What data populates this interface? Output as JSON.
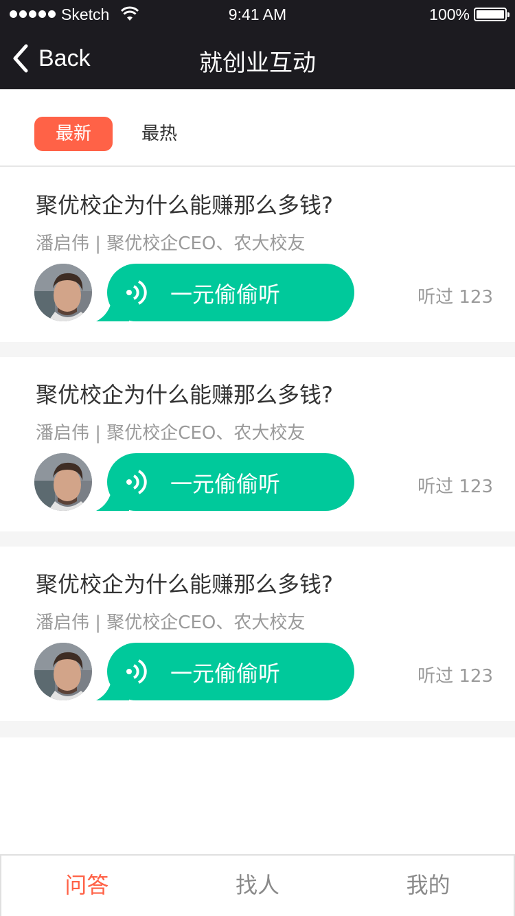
{
  "status": {
    "carrier": "Sketch",
    "time": "9:41 AM",
    "battery": "100%"
  },
  "nav": {
    "back_label": "Back",
    "title": "就创业互动"
  },
  "tabs": [
    {
      "label": "最新",
      "active": true
    },
    {
      "label": "最热",
      "active": false
    }
  ],
  "questions": [
    {
      "title": "聚优校企为什么能赚那么多钱?",
      "meta": "潘启伟 | 聚优校企CEO、农大校友",
      "listen_label": "一元偷偷听",
      "listens": "听过 123"
    },
    {
      "title": "聚优校企为什么能赚那么多钱?",
      "meta": "潘启伟 | 聚优校企CEO、农大校友",
      "listen_label": "一元偷偷听",
      "listens": "听过 123"
    },
    {
      "title": "聚优校企为什么能赚那么多钱?",
      "meta": "潘启伟 | 聚优校企CEO、农大校友",
      "listen_label": "一元偷偷听",
      "listens": "听过 123"
    }
  ],
  "tabbar": [
    {
      "label": "问答",
      "active": true
    },
    {
      "label": "找人",
      "active": false
    },
    {
      "label": "我的",
      "active": false
    }
  ],
  "colors": {
    "accent": "#ff6247",
    "bubble": "#00c99b",
    "header": "#1c1b20"
  }
}
